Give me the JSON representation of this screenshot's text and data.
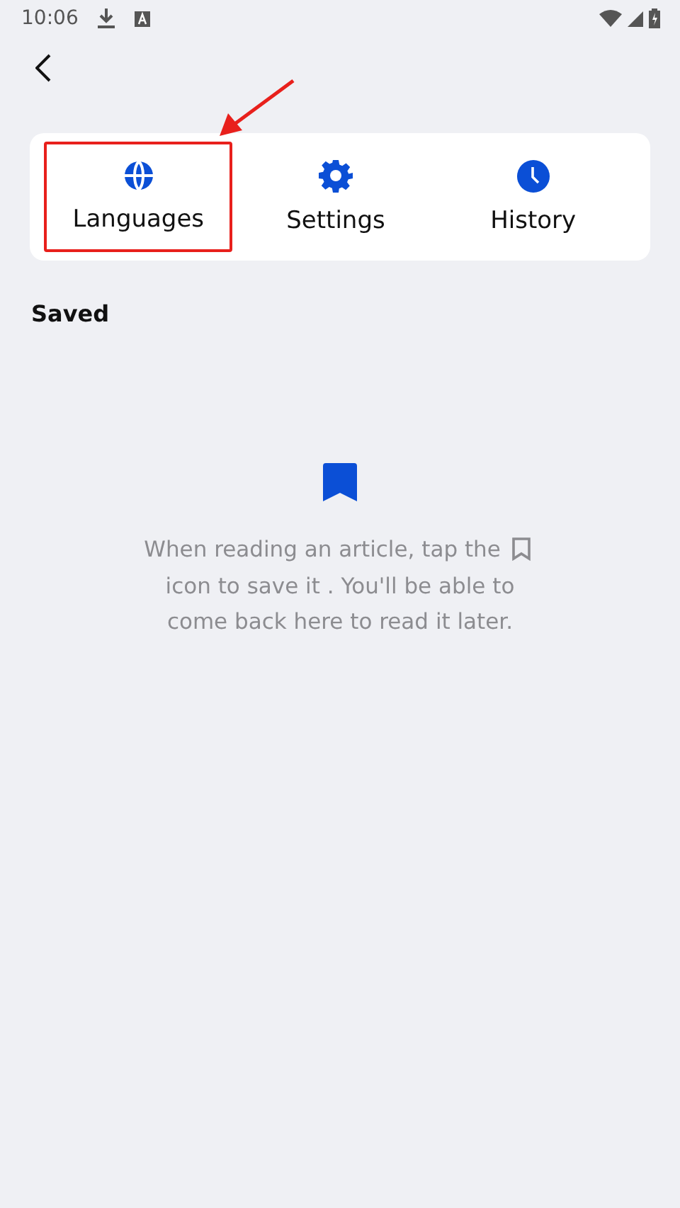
{
  "status_bar": {
    "time": "10:06"
  },
  "tabs": [
    {
      "label": "Languages",
      "kind": "globe",
      "annotated": true
    },
    {
      "label": "Settings",
      "kind": "gear",
      "annotated": false
    },
    {
      "label": "History",
      "kind": "clock",
      "annotated": false
    }
  ],
  "section_title": "Saved",
  "empty_state": {
    "message_before_icon": "When reading an article, tap the",
    "message_after_icon": "icon to save it . You'll be able to come back here to read it later."
  }
}
